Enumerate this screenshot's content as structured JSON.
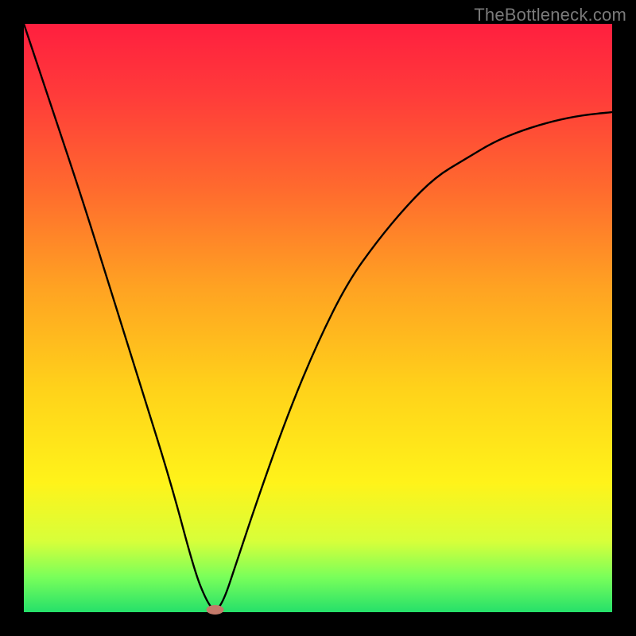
{
  "watermark": "TheBottleneck.com",
  "chart_data": {
    "type": "line",
    "title": "",
    "xlabel": "",
    "ylabel": "",
    "xlim": [
      0,
      100
    ],
    "ylim": [
      0,
      100
    ],
    "grid": false,
    "legend": false,
    "series": [
      {
        "name": "bottleneck-curve",
        "x": [
          0,
          5,
          10,
          15,
          20,
          25,
          29,
          31,
          32.5,
          34,
          36,
          40,
          45,
          50,
          55,
          60,
          65,
          70,
          75,
          80,
          85,
          90,
          95,
          100
        ],
        "values": [
          100,
          85,
          70,
          54,
          38,
          22,
          7,
          2,
          0,
          2,
          8,
          20,
          34,
          46,
          56,
          63,
          69,
          74,
          77,
          80,
          82,
          83.5,
          84.5,
          85
        ]
      }
    ],
    "min_marker": {
      "x": 32.5,
      "y": 0
    },
    "background_gradient": {
      "top": "#ff1f3f",
      "bottom": "#25e06a"
    }
  }
}
